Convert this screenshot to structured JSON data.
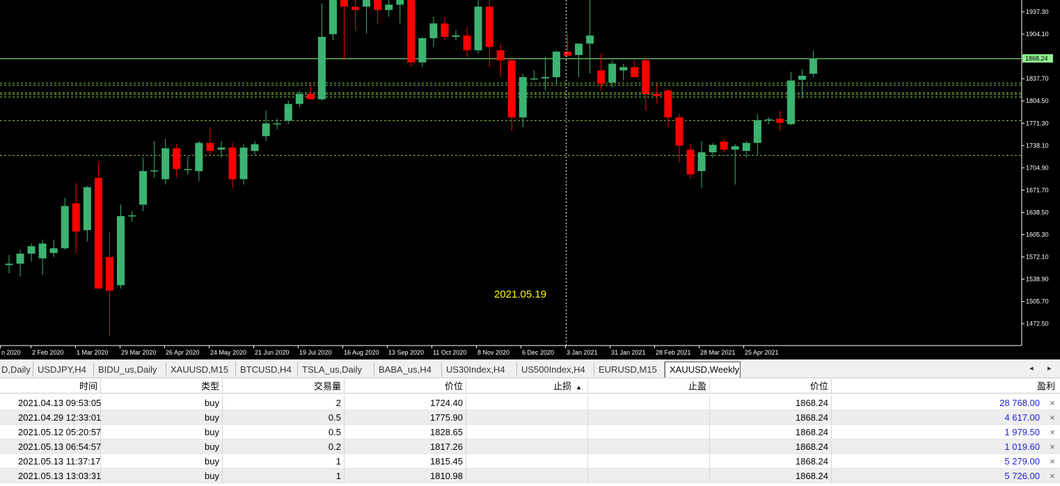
{
  "chart": {
    "crosshair_date": "2021.05.19",
    "current_price": "1868.24",
    "price_axis": [
      "1937.30",
      "1904.10",
      "1837.70",
      "1804.50",
      "1771.30",
      "1738.10",
      "1704.90",
      "1671.70",
      "1638.50",
      "1605.30",
      "1572.10",
      "1538.90",
      "1505.70",
      "1472.50"
    ],
    "date_axis": [
      "n 2020",
      "2 Feb 2020",
      "1 Mar 2020",
      "29 Mar 2020",
      "26 Apr 2020",
      "24 May 2020",
      "21 Jun 2020",
      "19 Jul 2020",
      "16 Aug 2020",
      "13 Sep 2020",
      "11 Oct 2020",
      "8 Nov 2020",
      "6 Dec 2020",
      "3 Jan 2021",
      "31 Jan 2021",
      "28 Feb 2021",
      "28 Mar 2021",
      "25 Apr 2021"
    ],
    "colors": {
      "bull": "#3cb371",
      "bear": "#ff0000",
      "bg": "#000000",
      "price_line": "#90ee90",
      "level_line": "#7fbf3f"
    },
    "candles": [
      {
        "o": 1560,
        "h": 1575,
        "l": 1548,
        "c": 1562
      },
      {
        "o": 1562,
        "h": 1583,
        "l": 1543,
        "c": 1577
      },
      {
        "o": 1577,
        "h": 1592,
        "l": 1565,
        "c": 1588
      },
      {
        "o": 1570,
        "h": 1598,
        "l": 1545,
        "c": 1592
      },
      {
        "o": 1578,
        "h": 1598,
        "l": 1572,
        "c": 1585
      },
      {
        "o": 1585,
        "h": 1660,
        "l": 1583,
        "c": 1648
      },
      {
        "o": 1652,
        "h": 1682,
        "l": 1578,
        "c": 1610
      },
      {
        "o": 1612,
        "h": 1678,
        "l": 1595,
        "c": 1676
      },
      {
        "o": 1690,
        "h": 1712,
        "l": 1610,
        "c": 1525
      },
      {
        "o": 1572,
        "h": 1610,
        "l": 1455,
        "c": 1522
      },
      {
        "o": 1530,
        "h": 1650,
        "l": 1525,
        "c": 1633
      },
      {
        "o": 1633,
        "h": 1640,
        "l": 1625,
        "c": 1634
      },
      {
        "o": 1650,
        "h": 1720,
        "l": 1640,
        "c": 1700
      },
      {
        "o": 1700,
        "h": 1745,
        "l": 1690,
        "c": 1701
      },
      {
        "o": 1688,
        "h": 1748,
        "l": 1680,
        "c": 1734
      },
      {
        "o": 1734,
        "h": 1740,
        "l": 1690,
        "c": 1703
      },
      {
        "o": 1702,
        "h": 1722,
        "l": 1695,
        "c": 1703
      },
      {
        "o": 1700,
        "h": 1745,
        "l": 1685,
        "c": 1742
      },
      {
        "o": 1742,
        "h": 1765,
        "l": 1725,
        "c": 1730
      },
      {
        "o": 1732,
        "h": 1745,
        "l": 1720,
        "c": 1735
      },
      {
        "o": 1735,
        "h": 1742,
        "l": 1675,
        "c": 1688
      },
      {
        "o": 1688,
        "h": 1740,
        "l": 1680,
        "c": 1735
      },
      {
        "o": 1730,
        "h": 1745,
        "l": 1725,
        "c": 1740
      },
      {
        "o": 1752,
        "h": 1790,
        "l": 1745,
        "c": 1771
      },
      {
        "o": 1770,
        "h": 1778,
        "l": 1762,
        "c": 1771
      },
      {
        "o": 1775,
        "h": 1805,
        "l": 1770,
        "c": 1800
      },
      {
        "o": 1800,
        "h": 1820,
        "l": 1795,
        "c": 1815
      },
      {
        "o": 1815,
        "h": 1830,
        "l": 1810,
        "c": 1807
      },
      {
        "o": 1807,
        "h": 1950,
        "l": 1805,
        "c": 1900
      },
      {
        "o": 1904,
        "h": 1975,
        "l": 1895,
        "c": 1975
      },
      {
        "o": 1975,
        "h": 1985,
        "l": 1865,
        "c": 1945
      },
      {
        "o": 1945,
        "h": 1985,
        "l": 1910,
        "c": 1940
      },
      {
        "o": 1945,
        "h": 1975,
        "l": 1905,
        "c": 1960
      },
      {
        "o": 1965,
        "h": 1985,
        "l": 1920,
        "c": 1940
      },
      {
        "o": 1940,
        "h": 1965,
        "l": 1930,
        "c": 1948
      },
      {
        "o": 1948,
        "h": 1968,
        "l": 1920,
        "c": 1958
      },
      {
        "o": 1958,
        "h": 1965,
        "l": 1855,
        "c": 1862
      },
      {
        "o": 1862,
        "h": 1900,
        "l": 1855,
        "c": 1898
      },
      {
        "o": 1898,
        "h": 1930,
        "l": 1885,
        "c": 1920
      },
      {
        "o": 1920,
        "h": 1930,
        "l": 1895,
        "c": 1900
      },
      {
        "o": 1900,
        "h": 1910,
        "l": 1895,
        "c": 1902
      },
      {
        "o": 1902,
        "h": 1915,
        "l": 1870,
        "c": 1880
      },
      {
        "o": 1880,
        "h": 1960,
        "l": 1875,
        "c": 1945
      },
      {
        "o": 1945,
        "h": 1955,
        "l": 1855,
        "c": 1885
      },
      {
        "o": 1880,
        "h": 1890,
        "l": 1840,
        "c": 1865
      },
      {
        "o": 1865,
        "h": 1870,
        "l": 1760,
        "c": 1780
      },
      {
        "o": 1780,
        "h": 1845,
        "l": 1765,
        "c": 1840
      },
      {
        "o": 1838,
        "h": 1850,
        "l": 1835,
        "c": 1838
      },
      {
        "o": 1838,
        "h": 1870,
        "l": 1820,
        "c": 1840
      },
      {
        "o": 1840,
        "h": 1880,
        "l": 1830,
        "c": 1878
      },
      {
        "o": 1878,
        "h": 1905,
        "l": 1870,
        "c": 1872
      },
      {
        "o": 1873,
        "h": 1890,
        "l": 1840,
        "c": 1890
      },
      {
        "o": 1890,
        "h": 1990,
        "l": 1845,
        "c": 1902
      },
      {
        "o": 1850,
        "h": 1875,
        "l": 1820,
        "c": 1830
      },
      {
        "o": 1832,
        "h": 1865,
        "l": 1825,
        "c": 1860
      },
      {
        "o": 1850,
        "h": 1860,
        "l": 1835,
        "c": 1855
      },
      {
        "o": 1855,
        "h": 1865,
        "l": 1840,
        "c": 1840
      },
      {
        "o": 1865,
        "h": 1870,
        "l": 1790,
        "c": 1815
      },
      {
        "o": 1815,
        "h": 1830,
        "l": 1800,
        "c": 1812
      },
      {
        "o": 1820,
        "h": 1822,
        "l": 1765,
        "c": 1780
      },
      {
        "o": 1780,
        "h": 1785,
        "l": 1712,
        "c": 1738
      },
      {
        "o": 1732,
        "h": 1740,
        "l": 1688,
        "c": 1695
      },
      {
        "o": 1700,
        "h": 1745,
        "l": 1675,
        "c": 1728
      },
      {
        "o": 1728,
        "h": 1742,
        "l": 1720,
        "c": 1739
      },
      {
        "o": 1744,
        "h": 1748,
        "l": 1728,
        "c": 1732
      },
      {
        "o": 1732,
        "h": 1740,
        "l": 1680,
        "c": 1737
      },
      {
        "o": 1730,
        "h": 1745,
        "l": 1720,
        "c": 1742
      },
      {
        "o": 1742,
        "h": 1785,
        "l": 1725,
        "c": 1776
      },
      {
        "o": 1776,
        "h": 1780,
        "l": 1770,
        "c": 1777
      },
      {
        "o": 1778,
        "h": 1790,
        "l": 1760,
        "c": 1772
      },
      {
        "o": 1770,
        "h": 1848,
        "l": 1768,
        "c": 1835
      },
      {
        "o": 1836,
        "h": 1852,
        "l": 1808,
        "c": 1842
      },
      {
        "o": 1845,
        "h": 1880,
        "l": 1840,
        "c": 1868
      }
    ],
    "levels": [
      {
        "price": 1868.24,
        "style": "solid"
      },
      {
        "price": 1832,
        "style": "dashed"
      },
      {
        "price": 1829,
        "style": "dashed"
      },
      {
        "price": 1817.26,
        "style": "dashed"
      },
      {
        "price": 1815.45,
        "style": "dashed"
      },
      {
        "price": 1810.98,
        "style": "dashed"
      },
      {
        "price": 1775.9,
        "style": "dashed"
      },
      {
        "price": 1724.4,
        "style": "dashed"
      }
    ]
  },
  "tabs": [
    {
      "label": "D,Daily",
      "active": false
    },
    {
      "label": "USDJPY,H4",
      "active": false
    },
    {
      "label": "BIDU_us,Daily",
      "active": false
    },
    {
      "label": "XAUUSD,M15",
      "active": false
    },
    {
      "label": "BTCUSD,H4",
      "active": false
    },
    {
      "label": "TSLA_us,Daily",
      "active": false
    },
    {
      "label": "BABA_us,H4",
      "active": false
    },
    {
      "label": "US30Index,H4",
      "active": false
    },
    {
      "label": "US500Index,H4",
      "active": false
    },
    {
      "label": "EURUSD,M15",
      "active": false
    },
    {
      "label": "XAUUSD,Weekly",
      "active": true
    }
  ],
  "tab_scroll": {
    "left": "◂",
    "right": "▸"
  },
  "table": {
    "headers": [
      "时间",
      "类型",
      "交易量",
      "价位",
      "止损",
      "止盈",
      "价位",
      "盈利"
    ],
    "rows": [
      {
        "time": "2021.04.13 09:53:05",
        "type": "buy",
        "volume": "2",
        "price": "1724.40",
        "sl": "",
        "tp": "",
        "cur": "1868.24",
        "profit": "28 768.00"
      },
      {
        "time": "2021.04.29 12:33:01",
        "type": "buy",
        "volume": "0.5",
        "price": "1775.90",
        "sl": "",
        "tp": "",
        "cur": "1868.24",
        "profit": "4 617.00"
      },
      {
        "time": "2021.05.12 05:20:57",
        "type": "buy",
        "volume": "0.5",
        "price": "1828.65",
        "sl": "",
        "tp": "",
        "cur": "1868.24",
        "profit": "1 979.50"
      },
      {
        "time": "2021.05.13 06:54:57",
        "type": "buy",
        "volume": "0.2",
        "price": "1817.26",
        "sl": "",
        "tp": "",
        "cur": "1868.24",
        "profit": "1 019.60"
      },
      {
        "time": "2021.05.13 11:37:17",
        "type": "buy",
        "volume": "1",
        "price": "1815.45",
        "sl": "",
        "tp": "",
        "cur": "1868.24",
        "profit": "5 279.00"
      },
      {
        "time": "2021.05.13 13:03:31",
        "type": "buy",
        "volume": "1",
        "price": "1810.98",
        "sl": "",
        "tp": "",
        "cur": "1868.24",
        "profit": "5 726.00"
      }
    ],
    "close_glyph": "×",
    "sort_glyph": "▲"
  }
}
